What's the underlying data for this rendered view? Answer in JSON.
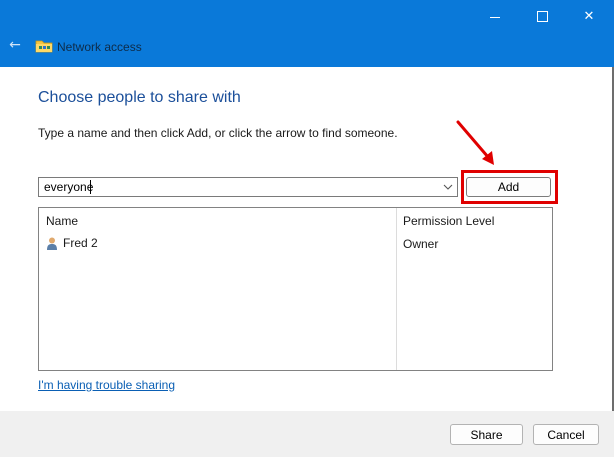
{
  "window": {
    "title": "Network access",
    "controls": {
      "minimize": "minimize",
      "maximize": "maximize",
      "close": "✕"
    }
  },
  "main": {
    "heading": "Choose people to share with",
    "instruction": "Type a name and then click Add, or click the arrow to find someone.",
    "name_input_value": "everyone",
    "add_label": "Add",
    "columns": {
      "name": "Name",
      "permission": "Permission Level"
    },
    "rows": [
      {
        "name": "Fred 2",
        "permission": "Owner",
        "icon": "user-icon"
      }
    ],
    "trouble_link": "I'm having trouble sharing"
  },
  "footer": {
    "share_label": "Share",
    "cancel_label": "Cancel"
  },
  "colors": {
    "titlebar": "#0a79d9",
    "heading": "#1b4f9a",
    "annotation": "#e00000",
    "link": "#0a5fb4"
  },
  "annotation": {
    "target": "Add",
    "type": "red-arrow-and-box"
  }
}
